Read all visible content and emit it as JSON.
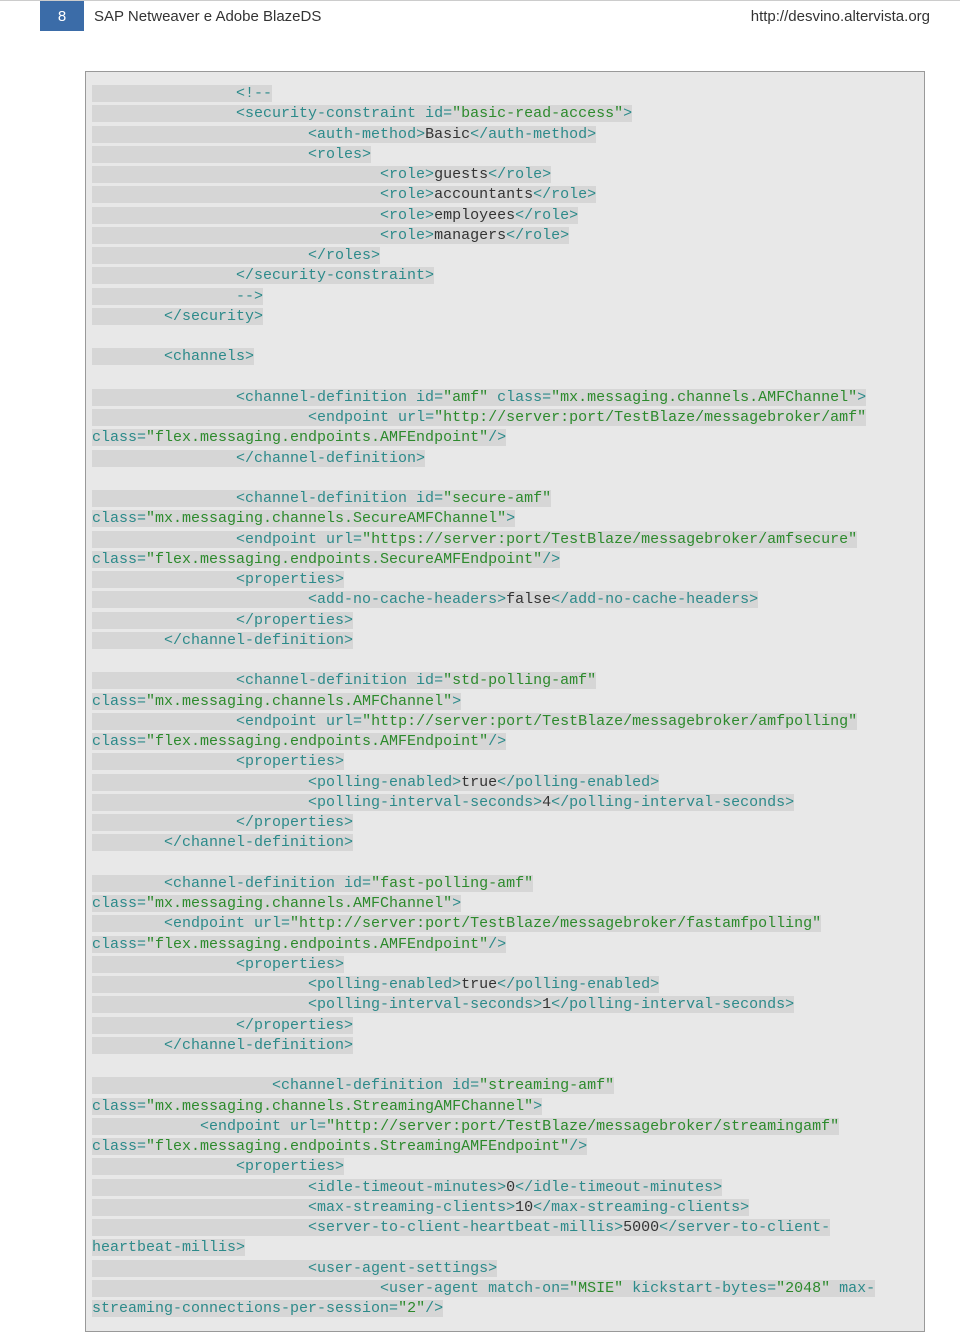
{
  "header": {
    "page_number": "8",
    "title": "SAP Netweaver e Adobe BlazeDS",
    "url": "http://desvino.altervista.org"
  },
  "code": {
    "lines": [
      {
        "indent": 16,
        "segs": [
          {
            "t": "t",
            "v": "<!--"
          }
        ]
      },
      {
        "indent": 16,
        "segs": [
          {
            "t": "t",
            "v": "<security-constraint id="
          },
          {
            "t": "s",
            "v": "\"basic-read-access\""
          },
          {
            "t": "t",
            "v": ">"
          }
        ]
      },
      {
        "indent": 24,
        "segs": [
          {
            "t": "t",
            "v": "<auth-method>"
          },
          {
            "t": "k",
            "v": "Basic"
          },
          {
            "t": "t",
            "v": "</auth-method>"
          }
        ]
      },
      {
        "indent": 24,
        "segs": [
          {
            "t": "t",
            "v": "<roles>"
          }
        ]
      },
      {
        "indent": 32,
        "segs": [
          {
            "t": "t",
            "v": "<role>"
          },
          {
            "t": "k",
            "v": "guests"
          },
          {
            "t": "t",
            "v": "</role>"
          }
        ]
      },
      {
        "indent": 32,
        "segs": [
          {
            "t": "t",
            "v": "<role>"
          },
          {
            "t": "k",
            "v": "accountants"
          },
          {
            "t": "t",
            "v": "</role>"
          }
        ]
      },
      {
        "indent": 32,
        "segs": [
          {
            "t": "t",
            "v": "<role>"
          },
          {
            "t": "k",
            "v": "employees"
          },
          {
            "t": "t",
            "v": "</role>"
          }
        ]
      },
      {
        "indent": 32,
        "segs": [
          {
            "t": "t",
            "v": "<role>"
          },
          {
            "t": "k",
            "v": "managers"
          },
          {
            "t": "t",
            "v": "</role>"
          }
        ]
      },
      {
        "indent": 24,
        "segs": [
          {
            "t": "t",
            "v": "</roles>"
          }
        ]
      },
      {
        "indent": 16,
        "segs": [
          {
            "t": "t",
            "v": "</security-constraint>"
          }
        ]
      },
      {
        "indent": 16,
        "segs": [
          {
            "t": "t",
            "v": "-->"
          }
        ]
      },
      {
        "indent": 8,
        "segs": [
          {
            "t": "t",
            "v": "</security>"
          }
        ]
      },
      {
        "blank": true
      },
      {
        "indent": 8,
        "segs": [
          {
            "t": "t",
            "v": "<channels>"
          }
        ]
      },
      {
        "blank": true
      },
      {
        "indent": 16,
        "segs": [
          {
            "t": "t",
            "v": "<channel-definition id="
          },
          {
            "t": "s",
            "v": "\"amf\""
          },
          {
            "t": "t",
            "v": " class="
          },
          {
            "t": "s",
            "v": "\"mx.messaging.channels.AMFChannel\""
          },
          {
            "t": "t",
            "v": ">"
          }
        ]
      },
      {
        "indent": 24,
        "segs": [
          {
            "t": "t",
            "v": "<endpoint url="
          },
          {
            "t": "s",
            "v": "\"http://server:port/TestBlaze/messagebroker/amf\""
          }
        ],
        "cont": true
      },
      {
        "indent": 0,
        "segs": [
          {
            "t": "t",
            "v": "class="
          },
          {
            "t": "s",
            "v": "\"flex.messaging.endpoints.AMFEndpoint\""
          },
          {
            "t": "t",
            "v": "/>"
          }
        ]
      },
      {
        "indent": 16,
        "segs": [
          {
            "t": "t",
            "v": "</channel-definition>"
          }
        ]
      },
      {
        "blank": true
      },
      {
        "indent": 16,
        "segs": [
          {
            "t": "t",
            "v": "<channel-definition id="
          },
          {
            "t": "s",
            "v": "\"secure-amf\""
          }
        ],
        "cont": true
      },
      {
        "indent": 0,
        "segs": [
          {
            "t": "t",
            "v": "class="
          },
          {
            "t": "s",
            "v": "\"mx.messaging.channels.SecureAMFChannel\""
          },
          {
            "t": "t",
            "v": ">"
          }
        ]
      },
      {
        "indent": 16,
        "segs": [
          {
            "t": "t",
            "v": "<endpoint url="
          },
          {
            "t": "s",
            "v": "\"https://server:port/TestBlaze/messagebroker/amfsecure\""
          }
        ],
        "cont": true
      },
      {
        "indent": 0,
        "segs": [
          {
            "t": "t",
            "v": "class="
          },
          {
            "t": "s",
            "v": "\"flex.messaging.endpoints.SecureAMFEndpoint\""
          },
          {
            "t": "t",
            "v": "/>"
          }
        ]
      },
      {
        "indent": 16,
        "segs": [
          {
            "t": "t",
            "v": "<properties>"
          }
        ]
      },
      {
        "indent": 24,
        "segs": [
          {
            "t": "t",
            "v": "<add-no-cache-headers>"
          },
          {
            "t": "k",
            "v": "false"
          },
          {
            "t": "t",
            "v": "</add-no-cache-headers>"
          }
        ]
      },
      {
        "indent": 16,
        "segs": [
          {
            "t": "t",
            "v": "</properties>"
          }
        ]
      },
      {
        "indent": 8,
        "segs": [
          {
            "t": "t",
            "v": "</channel-definition>"
          }
        ]
      },
      {
        "blank": true
      },
      {
        "indent": 16,
        "segs": [
          {
            "t": "t",
            "v": "<channel-definition id="
          },
          {
            "t": "s",
            "v": "\"std-polling-amf\""
          }
        ],
        "cont": true
      },
      {
        "indent": 0,
        "segs": [
          {
            "t": "t",
            "v": "class="
          },
          {
            "t": "s",
            "v": "\"mx.messaging.channels.AMFChannel\""
          },
          {
            "t": "t",
            "v": ">"
          }
        ]
      },
      {
        "indent": 16,
        "segs": [
          {
            "t": "t",
            "v": "<endpoint url="
          },
          {
            "t": "s",
            "v": "\"http://server:port/TestBlaze/messagebroker/amfpolling\""
          }
        ],
        "cont": true
      },
      {
        "indent": 0,
        "segs": [
          {
            "t": "t",
            "v": "class="
          },
          {
            "t": "s",
            "v": "\"flex.messaging.endpoints.AMFEndpoint\""
          },
          {
            "t": "t",
            "v": "/>"
          }
        ]
      },
      {
        "indent": 16,
        "segs": [
          {
            "t": "t",
            "v": "<properties>"
          }
        ]
      },
      {
        "indent": 24,
        "segs": [
          {
            "t": "t",
            "v": "<polling-enabled>"
          },
          {
            "t": "k",
            "v": "true"
          },
          {
            "t": "t",
            "v": "</polling-enabled>"
          }
        ]
      },
      {
        "indent": 24,
        "segs": [
          {
            "t": "t",
            "v": "<polling-interval-seconds>"
          },
          {
            "t": "k",
            "v": "4"
          },
          {
            "t": "t",
            "v": "</polling-interval-seconds>"
          }
        ]
      },
      {
        "indent": 16,
        "segs": [
          {
            "t": "t",
            "v": "</properties>"
          }
        ]
      },
      {
        "indent": 8,
        "segs": [
          {
            "t": "t",
            "v": "</channel-definition>"
          }
        ]
      },
      {
        "blank": true
      },
      {
        "indent": 8,
        "segs": [
          {
            "t": "t",
            "v": "<channel-definition id="
          },
          {
            "t": "s",
            "v": "\"fast-polling-amf\""
          }
        ],
        "cont": true
      },
      {
        "indent": 0,
        "segs": [
          {
            "t": "t",
            "v": "class="
          },
          {
            "t": "s",
            "v": "\"mx.messaging.channels.AMFChannel\""
          },
          {
            "t": "t",
            "v": ">"
          }
        ]
      },
      {
        "indent": 8,
        "segs": [
          {
            "t": "t",
            "v": "<endpoint url="
          },
          {
            "t": "s",
            "v": "\"http://server:port/TestBlaze/messagebroker/fastamfpolling\""
          }
        ],
        "cont": true
      },
      {
        "indent": 0,
        "segs": [
          {
            "t": "t",
            "v": "class="
          },
          {
            "t": "s",
            "v": "\"flex.messaging.endpoints.AMFEndpoint\""
          },
          {
            "t": "t",
            "v": "/>"
          }
        ]
      },
      {
        "indent": 16,
        "segs": [
          {
            "t": "t",
            "v": "<properties>"
          }
        ]
      },
      {
        "indent": 24,
        "segs": [
          {
            "t": "t",
            "v": "<polling-enabled>"
          },
          {
            "t": "k",
            "v": "true"
          },
          {
            "t": "t",
            "v": "</polling-enabled>"
          }
        ]
      },
      {
        "indent": 24,
        "segs": [
          {
            "t": "t",
            "v": "<polling-interval-seconds>"
          },
          {
            "t": "k",
            "v": "1"
          },
          {
            "t": "t",
            "v": "</polling-interval-seconds>"
          }
        ]
      },
      {
        "indent": 16,
        "segs": [
          {
            "t": "t",
            "v": "</properties>"
          }
        ]
      },
      {
        "indent": 8,
        "segs": [
          {
            "t": "t",
            "v": "</channel-definition>"
          }
        ]
      },
      {
        "blank": true
      },
      {
        "indent": 20,
        "segs": [
          {
            "t": "t",
            "v": "<channel-definition id="
          },
          {
            "t": "s",
            "v": "\"streaming-amf\""
          }
        ],
        "cont": true
      },
      {
        "indent": 0,
        "segs": [
          {
            "t": "t",
            "v": "class="
          },
          {
            "t": "s",
            "v": "\"mx.messaging.channels.StreamingAMFChannel\""
          },
          {
            "t": "t",
            "v": ">"
          }
        ]
      },
      {
        "indent": 12,
        "segs": [
          {
            "t": "t",
            "v": "<endpoint url="
          },
          {
            "t": "s",
            "v": "\"http://server:port/TestBlaze/messagebroker/streamingamf\""
          }
        ],
        "cont": true
      },
      {
        "indent": 0,
        "segs": [
          {
            "t": "t",
            "v": "class="
          },
          {
            "t": "s",
            "v": "\"flex.messaging.endpoints.StreamingAMFEndpoint\""
          },
          {
            "t": "t",
            "v": "/>"
          }
        ]
      },
      {
        "indent": 16,
        "segs": [
          {
            "t": "t",
            "v": "<properties>"
          }
        ]
      },
      {
        "indent": 24,
        "segs": [
          {
            "t": "t",
            "v": "<idle-timeout-minutes>"
          },
          {
            "t": "k",
            "v": "0"
          },
          {
            "t": "t",
            "v": "</idle-timeout-minutes>"
          }
        ]
      },
      {
        "indent": 24,
        "segs": [
          {
            "t": "t",
            "v": "<max-streaming-clients>"
          },
          {
            "t": "k",
            "v": "10"
          },
          {
            "t": "t",
            "v": "</max-streaming-clients>"
          }
        ]
      },
      {
        "indent": 24,
        "segs": [
          {
            "t": "t",
            "v": "<server-to-client-heartbeat-millis>"
          },
          {
            "t": "k",
            "v": "5000"
          },
          {
            "t": "t",
            "v": "</server-to-client-"
          }
        ],
        "cont": true
      },
      {
        "indent": 0,
        "segs": [
          {
            "t": "t",
            "v": "heartbeat-millis>"
          }
        ]
      },
      {
        "indent": 24,
        "segs": [
          {
            "t": "t",
            "v": "<user-agent-settings>"
          }
        ]
      },
      {
        "indent": 32,
        "segs": [
          {
            "t": "t",
            "v": "<user-agent match-on="
          },
          {
            "t": "s",
            "v": "\"MSIE\""
          },
          {
            "t": "t",
            "v": " kickstart-bytes="
          },
          {
            "t": "s",
            "v": "\"2048\""
          },
          {
            "t": "t",
            "v": " max-"
          }
        ],
        "cont": true
      },
      {
        "indent": 0,
        "segs": [
          {
            "t": "t",
            "v": "streaming-connections-per-session="
          },
          {
            "t": "s",
            "v": "\"2\""
          },
          {
            "t": "t",
            "v": "/>"
          }
        ]
      }
    ]
  }
}
